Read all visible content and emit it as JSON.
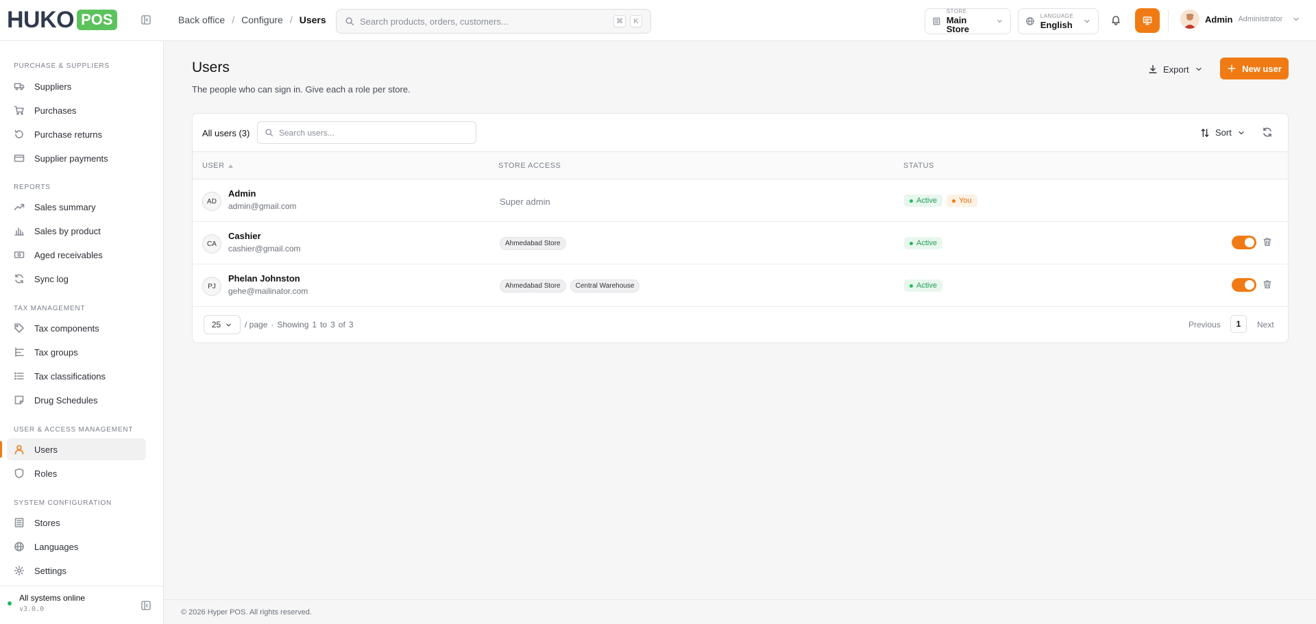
{
  "brand": {
    "word": "HUKO",
    "badge": "POS"
  },
  "breadcrumb": [
    "Back office",
    "Configure",
    "Users"
  ],
  "global_search": {
    "placeholder": "Search products, orders, customers...",
    "shortcut": [
      "⌘",
      "K"
    ]
  },
  "store": {
    "label": "STORE",
    "value": "Main Store"
  },
  "language": {
    "label": "LANGUAGE",
    "value": "English"
  },
  "user_menu": {
    "name": "Admin",
    "role": "Administrator"
  },
  "sidebar": {
    "sections": [
      {
        "title": "PURCHASE & SUPPLIERS",
        "items": [
          "Suppliers",
          "Purchases",
          "Purchase returns",
          "Supplier payments"
        ]
      },
      {
        "title": "REPORTS",
        "items": [
          "Sales summary",
          "Sales by product",
          "Aged receivables",
          "Sync log"
        ]
      },
      {
        "title": "TAX MANAGEMENT",
        "items": [
          "Tax components",
          "Tax groups",
          "Tax classifications",
          "Drug Schedules"
        ]
      },
      {
        "title": "USER & ACCESS MANAGEMENT",
        "items": [
          "Users",
          "Roles"
        ]
      },
      {
        "title": "SYSTEM CONFIGURATION",
        "items": [
          "Stores",
          "Languages",
          "Settings"
        ]
      }
    ],
    "active_item": "Users",
    "status": "All systems online",
    "version": "v3.0.0"
  },
  "page": {
    "title": "Users",
    "subtitle": "The people who can sign in. Give each a role per store.",
    "export_label": "Export",
    "new_label": "New user"
  },
  "table": {
    "count_label": "All users (3)",
    "search_placeholder": "Search users...",
    "sort_label": "Sort",
    "columns": [
      "USER",
      "STORE ACCESS",
      "STATUS"
    ],
    "rows": [
      {
        "initials": "AD",
        "name": "Admin",
        "email": "admin@gmail.com",
        "access_text": "Super admin",
        "access": [],
        "status": "Active",
        "you": "You",
        "toggle": null
      },
      {
        "initials": "CA",
        "name": "Cashier",
        "email": "cashier@gmail.com",
        "access_text": "",
        "access": [
          "Ahmedabad Store"
        ],
        "status": "Active",
        "you": "",
        "toggle": true
      },
      {
        "initials": "PJ",
        "name": "Phelan Johnston",
        "email": "gehe@mailinator.com",
        "access_text": "",
        "access": [
          "Ahmedabad Store",
          "Central Warehouse"
        ],
        "status": "Active",
        "you": "",
        "toggle": true
      }
    ],
    "pagination": {
      "per_page": "25",
      "per_page_suffix": "/ page",
      "showing": "Showing",
      "from": "1",
      "to_word": "to",
      "to": "3",
      "of_word": "of",
      "total": "3",
      "prev": "Previous",
      "page": "1",
      "next": "Next"
    }
  },
  "footer": "© 2026 Hyper POS. All rights reserved.",
  "colors": {
    "accent": "#f07b14",
    "success": "#28b463",
    "brand_green": "#5cc25c"
  }
}
